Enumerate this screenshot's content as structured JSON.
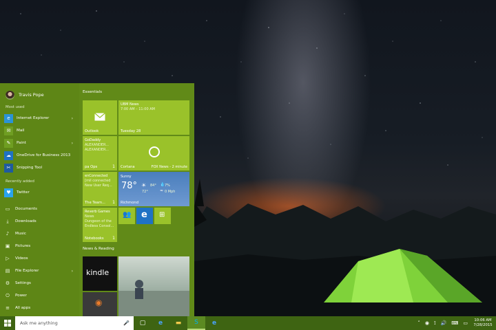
{
  "start_menu": {
    "user_name": "Travis Pope",
    "most_used_label": "Most used",
    "most_used": [
      {
        "label": "Internet Explorer",
        "icon": "ie-icon",
        "color": "#2b93d6",
        "glyph": "e",
        "has_submenu": true
      },
      {
        "label": "Mail",
        "icon": "mail-icon",
        "color": "#6f9e22",
        "glyph": "✉",
        "has_submenu": false
      },
      {
        "label": "Paint",
        "icon": "paint-icon",
        "color": "#6f9e22",
        "glyph": "✎",
        "has_submenu": true
      },
      {
        "label": "OneDrive for Business 2013",
        "icon": "onedrive-icon",
        "color": "#1f72c4",
        "glyph": "☁",
        "has_submenu": false
      },
      {
        "label": "Snipping Tool",
        "icon": "snipping-tool-icon",
        "color": "#1f5b9e",
        "glyph": "✂",
        "has_submenu": false
      }
    ],
    "recently_added_label": "Recently added",
    "recently_added": [
      {
        "label": "Twitter",
        "icon": "twitter-icon",
        "color": "#2aa3ef",
        "glyph": "🐦"
      }
    ],
    "places": [
      {
        "label": "Documents",
        "icon": "documents-icon",
        "glyph": "▭",
        "has_submenu": false
      },
      {
        "label": "Downloads",
        "icon": "downloads-icon",
        "glyph": "⤓",
        "has_submenu": false
      },
      {
        "label": "Music",
        "icon": "music-icon",
        "glyph": "♪",
        "has_submenu": false
      },
      {
        "label": "Pictures",
        "icon": "pictures-icon",
        "glyph": "▣",
        "has_submenu": false
      },
      {
        "label": "Videos",
        "icon": "videos-icon",
        "glyph": "▷",
        "has_submenu": false
      },
      {
        "label": "File Explorer",
        "icon": "file-explorer-icon",
        "glyph": "▤",
        "has_submenu": true
      },
      {
        "label": "Settings",
        "icon": "settings-icon",
        "glyph": "⚙",
        "has_submenu": false
      },
      {
        "label": "Power",
        "icon": "power-icon",
        "glyph": "⏻",
        "has_submenu": false
      },
      {
        "label": "All apps",
        "icon": "all-apps-icon",
        "glyph": "≡",
        "has_submenu": false
      }
    ],
    "groups": {
      "essentials": "Essentials",
      "news_reading": "News & Reading"
    },
    "tiles": {
      "outlook": {
        "name": "Outlook"
      },
      "news": {
        "line1": "UBM News",
        "line2": "7:00 AM – 11:00 AM",
        "line3": "Tuesday 28"
      },
      "people_pa": {
        "line1": "GoDaddy",
        "line2": "ALEXANDER...",
        "line3": "ALEXANDER...",
        "name": "pa Ops",
        "badge": "1"
      },
      "cortana": {
        "name": "Cortana",
        "news": "FOX News - 2 minute"
      },
      "enconnected": {
        "line1": "enConnected",
        "line2": "[mil connected",
        "line3": "New User Req...",
        "name": "The Team...",
        "badge": "1"
      },
      "weather": {
        "condition": "Sunny",
        "temp": "78°",
        "high": "84°",
        "low": "72°",
        "precip": "7%",
        "wind": "0 Mph",
        "city": "Richmond"
      },
      "notebooks": {
        "line1": "Reverb Games",
        "line2": "News",
        "line3": "Dungeon of the",
        "line4": "Endless Consol...",
        "name": "Notebooks",
        "badge": "1"
      },
      "kindle": {
        "label": "kindle"
      }
    }
  },
  "taskbar": {
    "search_placeholder": "Ask me anything",
    "time": "10:06 AM",
    "date": "7/28/2015",
    "accent": "#3e6412"
  }
}
